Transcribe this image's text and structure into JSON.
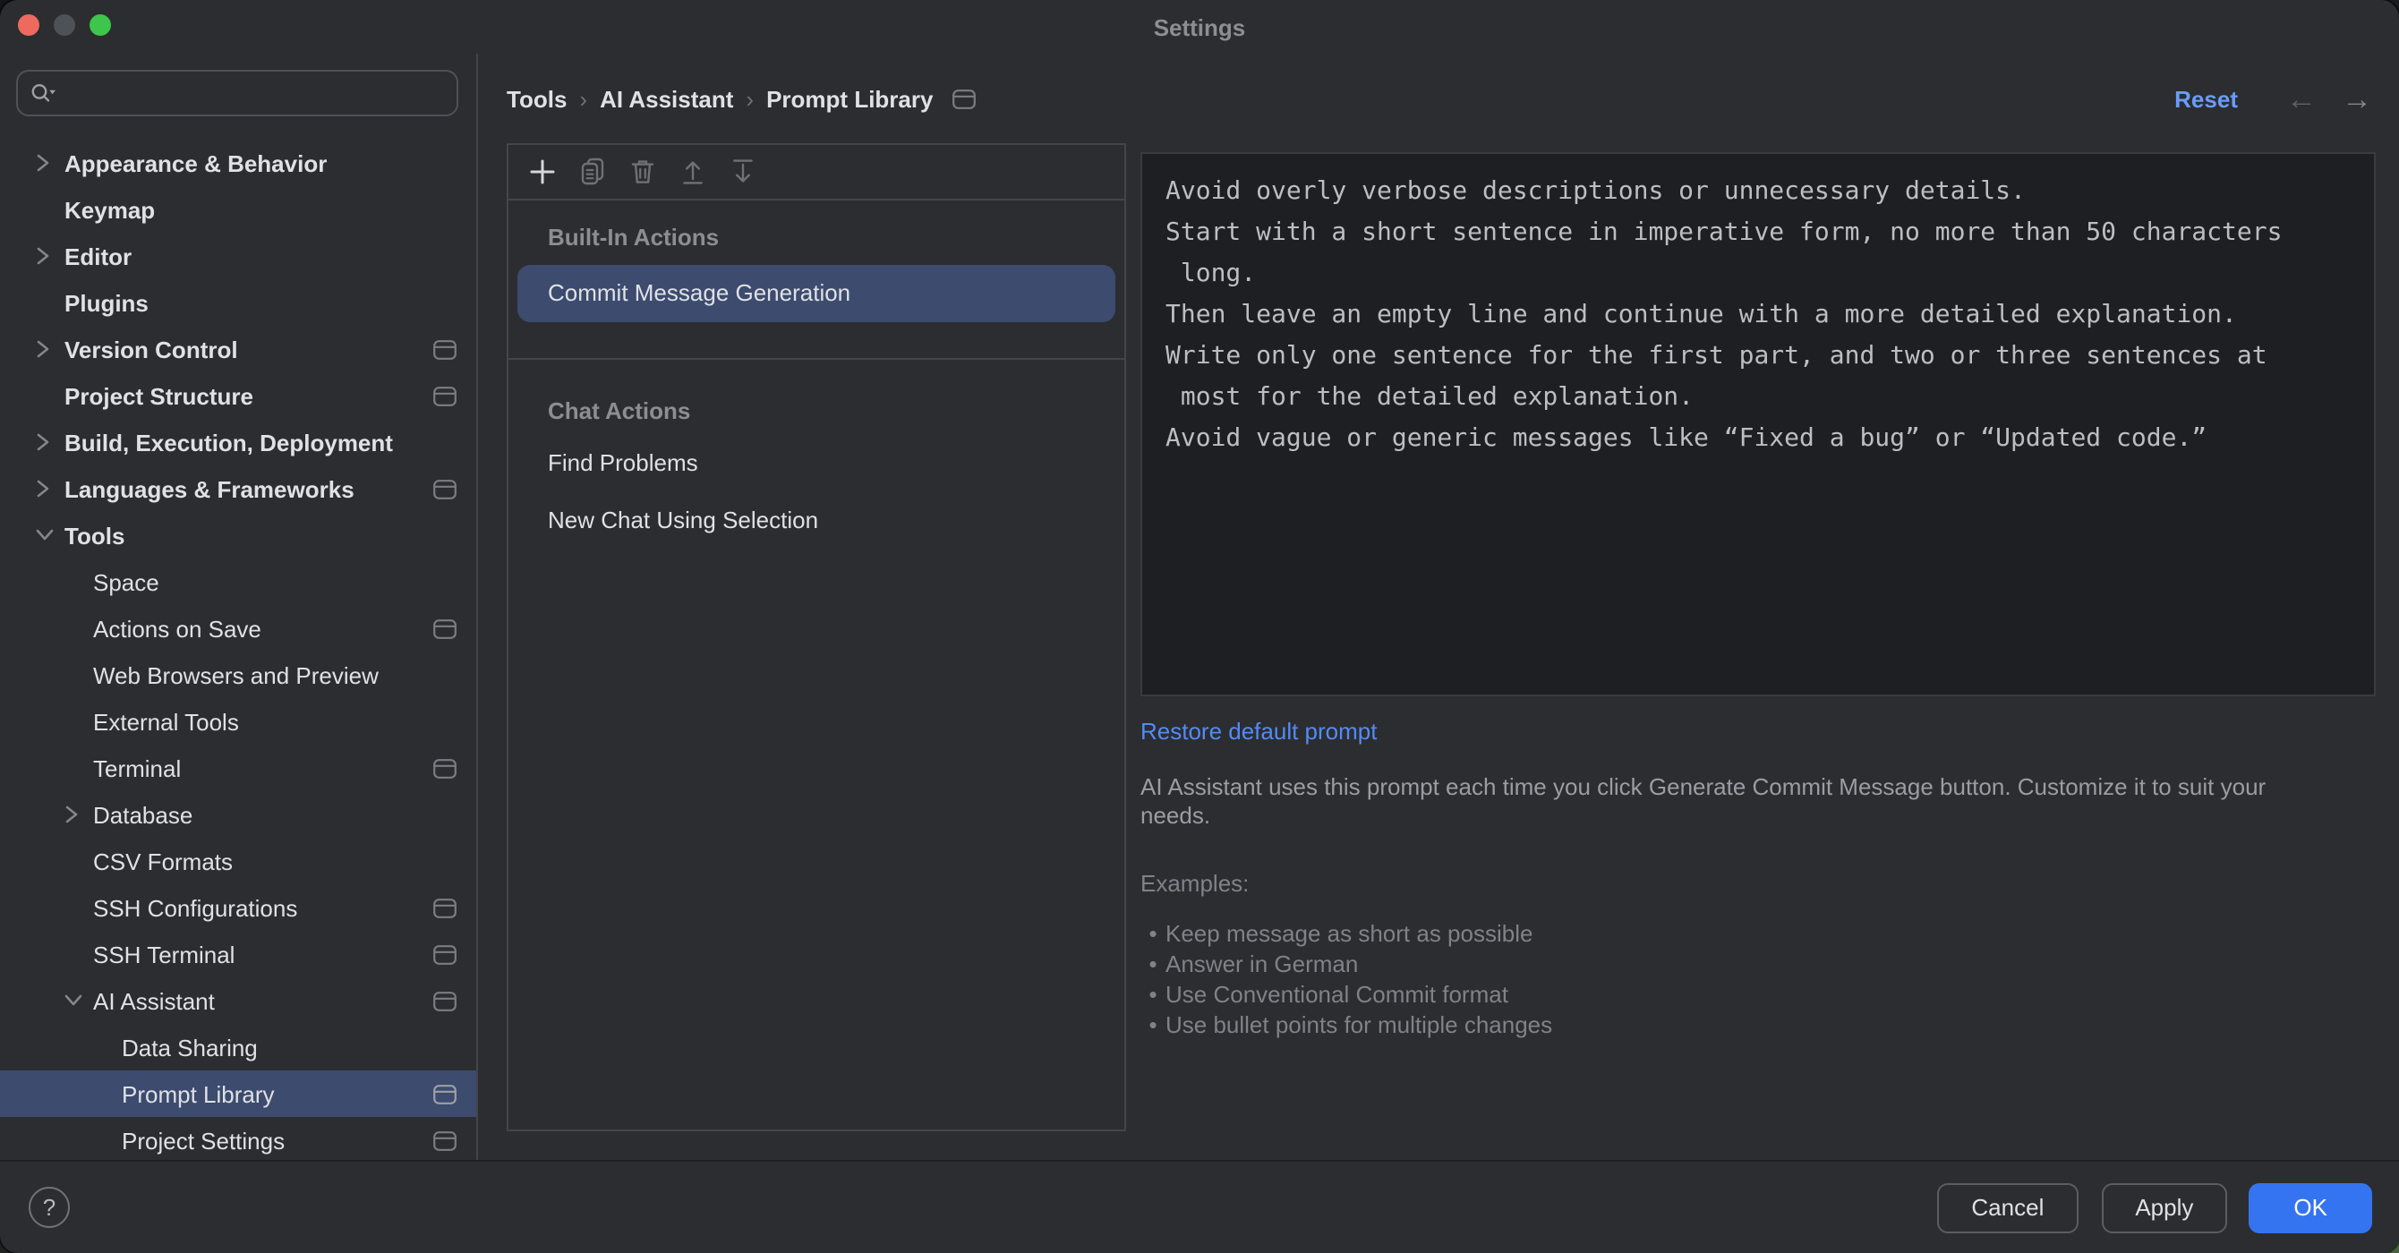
{
  "window": {
    "title": "Settings"
  },
  "sidebar": {
    "search": {
      "placeholder": "",
      "value": ""
    },
    "items": [
      {
        "label": "Appearance & Behavior",
        "level": 0,
        "chevron": "right",
        "per_project": false
      },
      {
        "label": "Keymap",
        "level": 0,
        "chevron": null,
        "per_project": false
      },
      {
        "label": "Editor",
        "level": 0,
        "chevron": "right",
        "per_project": false
      },
      {
        "label": "Plugins",
        "level": 0,
        "chevron": null,
        "per_project": false
      },
      {
        "label": "Version Control",
        "level": 0,
        "chevron": "right",
        "per_project": true
      },
      {
        "label": "Project Structure",
        "level": 0,
        "chevron": null,
        "per_project": true
      },
      {
        "label": "Build, Execution, Deployment",
        "level": 0,
        "chevron": "right",
        "per_project": false
      },
      {
        "label": "Languages & Frameworks",
        "level": 0,
        "chevron": "right",
        "per_project": true
      },
      {
        "label": "Tools",
        "level": 0,
        "chevron": "down",
        "per_project": false
      },
      {
        "label": "Space",
        "level": 1,
        "chevron": null,
        "per_project": false
      },
      {
        "label": "Actions on Save",
        "level": 1,
        "chevron": null,
        "per_project": true
      },
      {
        "label": "Web Browsers and Preview",
        "level": 1,
        "chevron": null,
        "per_project": false
      },
      {
        "label": "External Tools",
        "level": 1,
        "chevron": null,
        "per_project": false
      },
      {
        "label": "Terminal",
        "level": 1,
        "chevron": null,
        "per_project": true
      },
      {
        "label": "Database",
        "level": 1,
        "chevron": "right",
        "per_project": false
      },
      {
        "label": "CSV Formats",
        "level": 1,
        "chevron": null,
        "per_project": false
      },
      {
        "label": "SSH Configurations",
        "level": 1,
        "chevron": null,
        "per_project": true
      },
      {
        "label": "SSH Terminal",
        "level": 1,
        "chevron": null,
        "per_project": true
      },
      {
        "label": "AI Assistant",
        "level": 1,
        "chevron": "down",
        "per_project": true
      },
      {
        "label": "Data Sharing",
        "level": 2,
        "chevron": null,
        "per_project": false
      },
      {
        "label": "Prompt Library",
        "level": 2,
        "chevron": null,
        "per_project": true,
        "selected": true
      },
      {
        "label": "Project Settings",
        "level": 2,
        "chevron": null,
        "per_project": true
      }
    ]
  },
  "breadcrumb": {
    "separator": "›",
    "items": [
      "Tools",
      "AI Assistant",
      "Prompt Library"
    ]
  },
  "topbar": {
    "reset": "Reset",
    "back_icon": "←",
    "forward_icon": "→"
  },
  "actions_panel": {
    "toolbar_icons": [
      "add-icon",
      "duplicate-icon",
      "delete-icon",
      "export-icon",
      "import-icon"
    ],
    "groups": [
      {
        "header": "Built-In Actions",
        "items": [
          {
            "label": "Commit Message Generation",
            "selected": true
          }
        ]
      },
      {
        "header": "Chat Actions",
        "items": [
          {
            "label": "Find Problems",
            "selected": false
          },
          {
            "label": "New Chat Using Selection",
            "selected": false
          }
        ]
      }
    ]
  },
  "details": {
    "prompt_lines": [
      "Avoid overly verbose descriptions or unnecessary details.",
      "Start with a short sentence in imperative form, no more than 50 characters",
      " long.",
      "Then leave an empty line and continue with a more detailed explanation.",
      "Write only one sentence for the first part, and two or three sentences at",
      " most for the detailed explanation.",
      "Avoid vague or generic messages like “Fixed a bug” or “Updated code.”"
    ],
    "restore_link": "Restore default prompt",
    "description_lines": [
      "AI Assistant uses this prompt each time you click Generate Commit Message button. Customize it to suit your",
      "needs."
    ],
    "examples_title": "Examples:",
    "bullet_char": "•",
    "examples": [
      "Keep message as short as possible",
      "Answer in German",
      "Use Conventional Commit format",
      "Use bullet points for multiple changes"
    ]
  },
  "footer": {
    "help": "?",
    "cancel": "Cancel",
    "apply": "Apply",
    "ok": "OK"
  },
  "colors": {
    "window_bg": "#2B2D30",
    "editor_bg": "#1E1F22",
    "panel_border": "#43454A",
    "selection": "#3C4B6E",
    "accent": "#3574F0",
    "link": "#548AF7",
    "reset_link": "#6B9BFA"
  }
}
